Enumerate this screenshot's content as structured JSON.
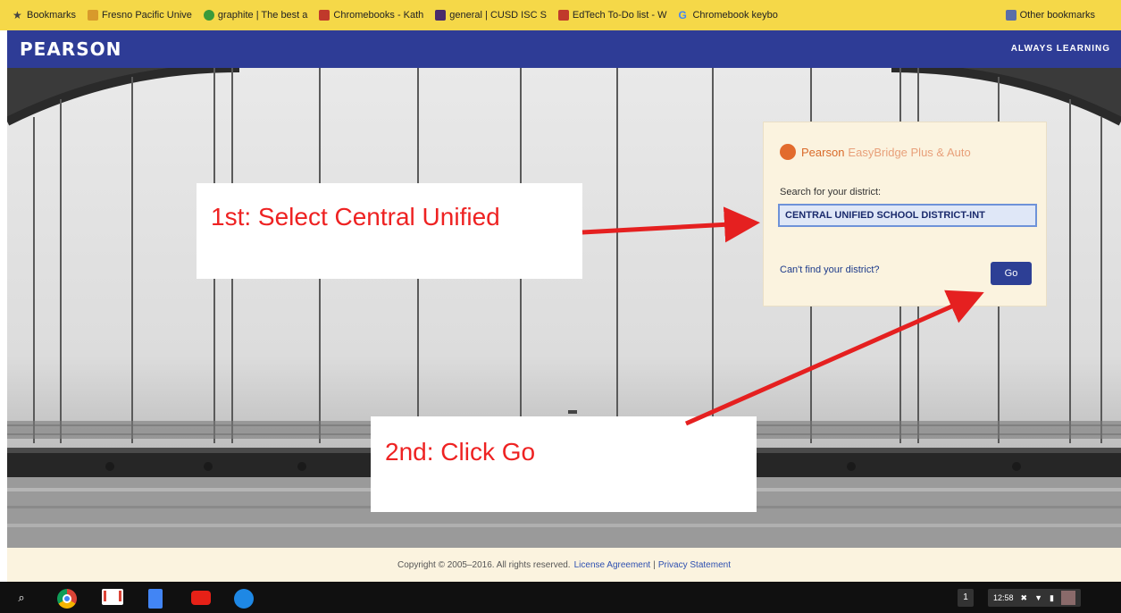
{
  "bookmarks": {
    "items": [
      {
        "label": "Bookmarks",
        "icon": "star-icon",
        "color": "#444444"
      },
      {
        "label": "Fresno Pacific Unive",
        "icon": "fpu-icon",
        "color": "#d89a2b"
      },
      {
        "label": "graphite | The best a",
        "icon": "graphite-icon",
        "color": "#3a9a3a"
      },
      {
        "label": "Chromebooks - Kath",
        "icon": "chromebooks-icon",
        "color": "#c0392b"
      },
      {
        "label": "general | CUSD ISC S",
        "icon": "slack-icon",
        "color": "#4a2c6b"
      },
      {
        "label": "EdTech To-Do list - W",
        "icon": "todo-icon",
        "color": "#c0392b"
      },
      {
        "label": "Chromebook keybo",
        "icon": "google-icon",
        "color": "#4285f4"
      }
    ],
    "other": "Other bookmarks"
  },
  "header": {
    "logo": "PEARSON",
    "tagline": "ALWAYS LEARNING"
  },
  "card": {
    "brand_name": "Pearson",
    "product": "EasyBridge Plus & Auto",
    "search_label": "Search for your district:",
    "search_value": "CENTRAL UNIFIED SCHOOL DISTRICT-INT",
    "cant_find": "Can't find your district?",
    "go_label": "Go"
  },
  "annotations": {
    "step1": "1st: Select Central Unified",
    "step2": "2nd: Click Go",
    "arrow_color": "#e52020"
  },
  "footer": {
    "copyright": "Copyright © 2005–2016. All rights reserved.",
    "license": "License Agreement",
    "separator": "|",
    "privacy": "Privacy Statement"
  },
  "taskbar": {
    "apps": [
      "search-icon",
      "chrome-icon",
      "gmail-icon",
      "docs-icon",
      "youtube-icon",
      "files-icon"
    ],
    "notification_count": "1",
    "time": "12:58"
  },
  "colors": {
    "bookmark_bar": "#f5d848",
    "header": "#2e3c96",
    "card_bg": "#fbf3df",
    "go_button": "#2d3f95"
  }
}
